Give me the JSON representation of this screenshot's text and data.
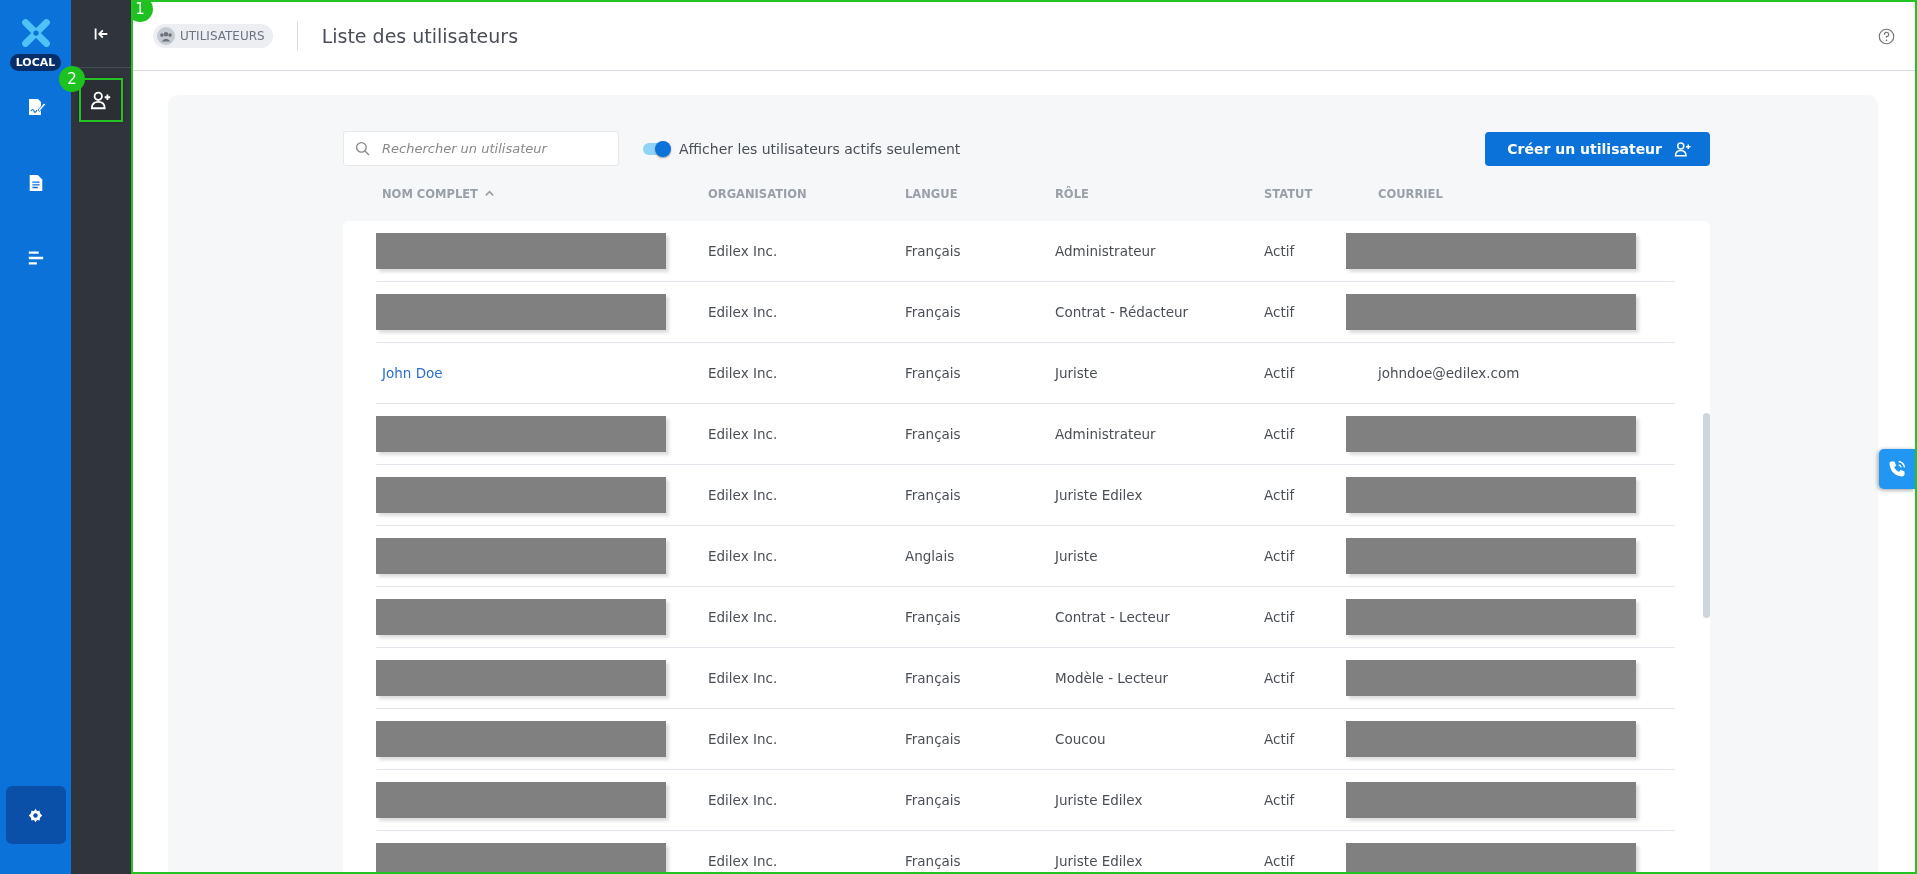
{
  "rail": {
    "badge": "LOCAL"
  },
  "panel": {
    "add_user_button": {
      "callout": "2"
    }
  },
  "main": {
    "callout": "1",
    "header": {
      "section_chip": "UTILISATEURS",
      "title": "Liste des utilisateurs"
    },
    "toolbar": {
      "search": {
        "placeholder": "Rechercher un utilisateur"
      },
      "active_toggle": {
        "on": true,
        "label": "Afficher les utilisateurs actifs seulement"
      },
      "create_button": "Créer un utilisateur"
    },
    "table": {
      "columns": [
        {
          "label": "NOM COMPLET",
          "sorted": true
        },
        {
          "label": "ORGANISATION",
          "sorted": false
        },
        {
          "label": "LANGUE",
          "sorted": false
        },
        {
          "label": "RÔLE",
          "sorted": false
        },
        {
          "label": "STATUT",
          "sorted": false
        },
        {
          "label": "COURRIEL",
          "sorted": false
        }
      ],
      "rows": [
        {
          "kind": "redacted",
          "organisation": "Edilex Inc.",
          "langue": "Français",
          "role": "Administrateur",
          "statut": "Actif"
        },
        {
          "kind": "redacted",
          "organisation": "Edilex Inc.",
          "langue": "Français",
          "role": "Contrat - Rédacteur",
          "statut": "Actif"
        },
        {
          "kind": "visible",
          "name": "John Doe",
          "organisation": "Edilex Inc.",
          "langue": "Français",
          "role": "Juriste",
          "statut": "Actif",
          "email": "johndoe@edilex.com"
        },
        {
          "kind": "redacted",
          "organisation": "Edilex Inc.",
          "langue": "Français",
          "role": "Administrateur",
          "statut": "Actif"
        },
        {
          "kind": "redacted",
          "organisation": "Edilex Inc.",
          "langue": "Français",
          "role": "Juriste Edilex",
          "statut": "Actif"
        },
        {
          "kind": "redacted",
          "organisation": "Edilex Inc.",
          "langue": "Anglais",
          "role": "Juriste",
          "statut": "Actif"
        },
        {
          "kind": "redacted",
          "organisation": "Edilex Inc.",
          "langue": "Français",
          "role": "Contrat - Lecteur",
          "statut": "Actif"
        },
        {
          "kind": "redacted",
          "organisation": "Edilex Inc.",
          "langue": "Français",
          "role": "Modèle - Lecteur",
          "statut": "Actif"
        },
        {
          "kind": "redacted",
          "organisation": "Edilex Inc.",
          "langue": "Français",
          "role": "Coucou",
          "statut": "Actif"
        },
        {
          "kind": "redacted",
          "organisation": "Edilex Inc.",
          "langue": "Français",
          "role": "Juriste Edilex",
          "statut": "Actif"
        },
        {
          "kind": "redacted",
          "organisation": "Edilex Inc.",
          "langue": "Français",
          "role": "Juriste Edilex",
          "statut": "Actif"
        }
      ]
    }
  }
}
